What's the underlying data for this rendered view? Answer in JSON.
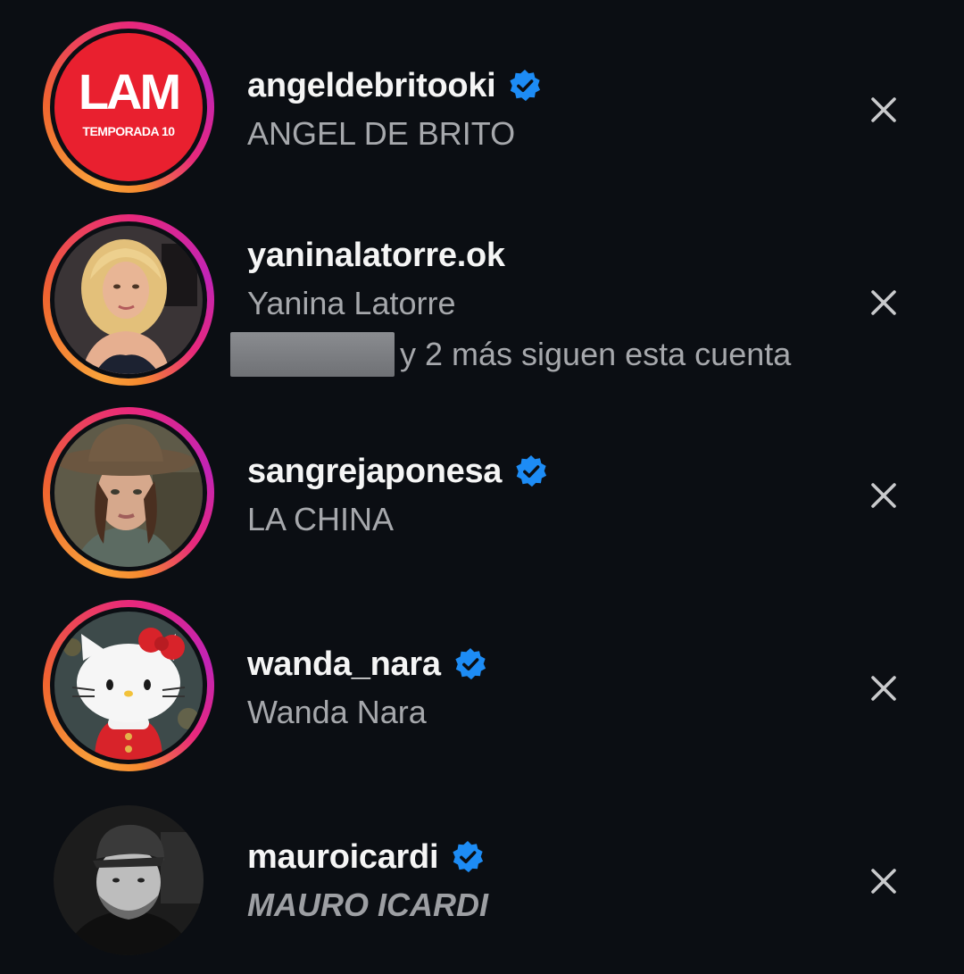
{
  "suggestions": [
    {
      "username": "angeldebritooki",
      "full_name": "ANGEL DE BRITO",
      "verified": true,
      "has_story_ring": true,
      "avatar": {
        "kind": "logo",
        "logo_main": "LAM",
        "logo_sub": "TEMPORADA 10",
        "bg_color": "#e9202f"
      }
    },
    {
      "username": "yaninalatorre.ok",
      "full_name": "Yanina Latorre",
      "verified": false,
      "has_story_ring": true,
      "mutual_text": "y 2 más siguen esta cuenta",
      "avatar": {
        "kind": "photo",
        "desc_icon": "woman-portrait-icon"
      }
    },
    {
      "username": "sangrejaponesa",
      "full_name": "LA CHINA",
      "verified": true,
      "has_story_ring": true,
      "avatar": {
        "kind": "photo",
        "desc_icon": "woman-with-hat-portrait-icon"
      }
    },
    {
      "username": "wanda_nara",
      "full_name": "Wanda Nara",
      "verified": true,
      "has_story_ring": true,
      "avatar": {
        "kind": "illustration",
        "desc_icon": "hello-kitty-icon"
      }
    },
    {
      "username": "mauroicardi",
      "full_name": "MAURO ICARDI",
      "verified": true,
      "has_story_ring": false,
      "avatar": {
        "kind": "photo",
        "desc_icon": "man-with-cap-portrait-icon"
      }
    }
  ],
  "colors": {
    "background": "#0b0e13",
    "username": "#f5f5f5",
    "secondary_text": "#a6a8ac",
    "verified_badge": "#1d8cf5",
    "dismiss_icon": "#c9cacc"
  }
}
